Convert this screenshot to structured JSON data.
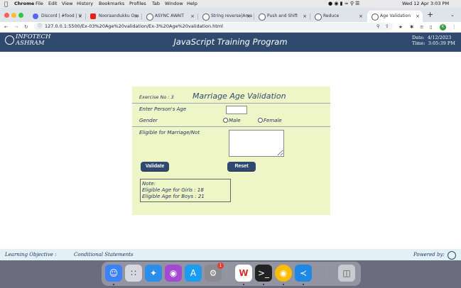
{
  "menubar": {
    "app": "Chrome",
    "items": [
      "File",
      "Edit",
      "View",
      "History",
      "Bookmarks",
      "Profiles",
      "Tab",
      "Window",
      "Help"
    ],
    "clock": "Wed 12 Apr  3:03 PM"
  },
  "tabs": [
    {
      "label": "Discord | #food | V",
      "color": "#5865f2"
    },
    {
      "label": "Nooraandukku Oru",
      "color": "#e62117"
    },
    {
      "label": "ASYNC AWAIT",
      "color": "#555555"
    },
    {
      "label": "String reverse|Ama",
      "color": "#555555"
    },
    {
      "label": "Push and Shift",
      "color": "#555555"
    },
    {
      "label": "Reduce",
      "color": "#555555"
    },
    {
      "label": "Age Validation",
      "color": "#555555"
    }
  ],
  "address": {
    "url": "127.0.0.1:5500/Ex-03%20Age%20validation/Ex-3%20Age%20validation.html",
    "profile_initial": "K"
  },
  "header": {
    "logo_line1": "INFOTECH",
    "logo_line2": "ASHRAM",
    "title": "JavaScript Training Program",
    "date_label": "Date:",
    "date_value": "4/12/2023",
    "time_label": "Time:",
    "time_value": "3:05:39 PM"
  },
  "form": {
    "exercise": "Exercise No : 3",
    "heading": "Marriage Age Validation",
    "age_label": "Enter Person's Age",
    "age_value": "",
    "gender_label": "Gender",
    "male": "Male",
    "female": "Female",
    "eligible_label": "Eligible for Marriage/Not",
    "result_value": "",
    "validate_label": "Validate",
    "reset_label": "Reset",
    "note_title": "Note:",
    "note_girls": "Eligible Age for Girls  :  18",
    "note_boys": "Eligible Age for Boys :  21"
  },
  "footer": {
    "objective_label": "Learning Objective :",
    "objective_value": "Conditional Statements",
    "powered_by": "Powered by:"
  },
  "dock": {
    "notification_badge": "1",
    "icons": [
      "finder-icon",
      "launchpad-icon",
      "safari-icon",
      "podcasts-icon",
      "app-store-icon",
      "system-settings-icon",
      "wps-office-icon",
      "terminal-icon",
      "chrome-icon",
      "vscode-icon",
      "trash-icon"
    ]
  }
}
